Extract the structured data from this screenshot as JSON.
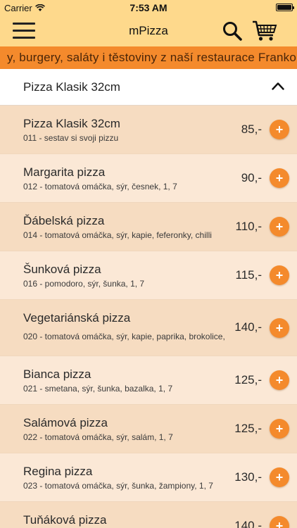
{
  "status_bar": {
    "carrier": "Carrier",
    "time": "7:53 AM"
  },
  "nav": {
    "title": "mPizza"
  },
  "ticker": {
    "text": "y, burgery, saláty i těstoviny z naší restaurace Franko"
  },
  "category": {
    "title": "Pizza Klasik 32cm"
  },
  "add_label": "+",
  "items": [
    {
      "name": "Pizza Klasik 32cm",
      "desc": "011 - sestav si svoji pizzu",
      "price": "85,-"
    },
    {
      "name": "Margarita pizza",
      "desc": "012 - tomatová omáčka, sýr, česnek, 1, 7",
      "price": "90,-"
    },
    {
      "name": "Ďábelská pizza",
      "desc": "014 - tomatová omáčka, sýr, kapie, feferonky, chilli",
      "price": "110,-"
    },
    {
      "name": "Šunková pizza",
      "desc": "016 - pomodoro, sýr, šunka, 1, 7",
      "price": "115,-"
    },
    {
      "name": "Vegetariánská pizza",
      "desc": "020 - tomatová omáčka, sýr, kapie, paprika, brokolice,",
      "price": "140,-"
    },
    {
      "name": "Bianca pizza",
      "desc": "021 - smetana, sýr, šunka, bazalka, 1, 7",
      "price": "125,-"
    },
    {
      "name": "Salámová pizza",
      "desc": "022 - tomatová omáčka, sýr, salám, 1, 7",
      "price": "125,-"
    },
    {
      "name": "Regina pizza",
      "desc": "023 - tomatová omáčka, sýr, šunka, žampiony, 1, 7",
      "price": "130,-"
    },
    {
      "name": "Tuňáková pizza",
      "desc": "",
      "price": "140,-"
    }
  ]
}
